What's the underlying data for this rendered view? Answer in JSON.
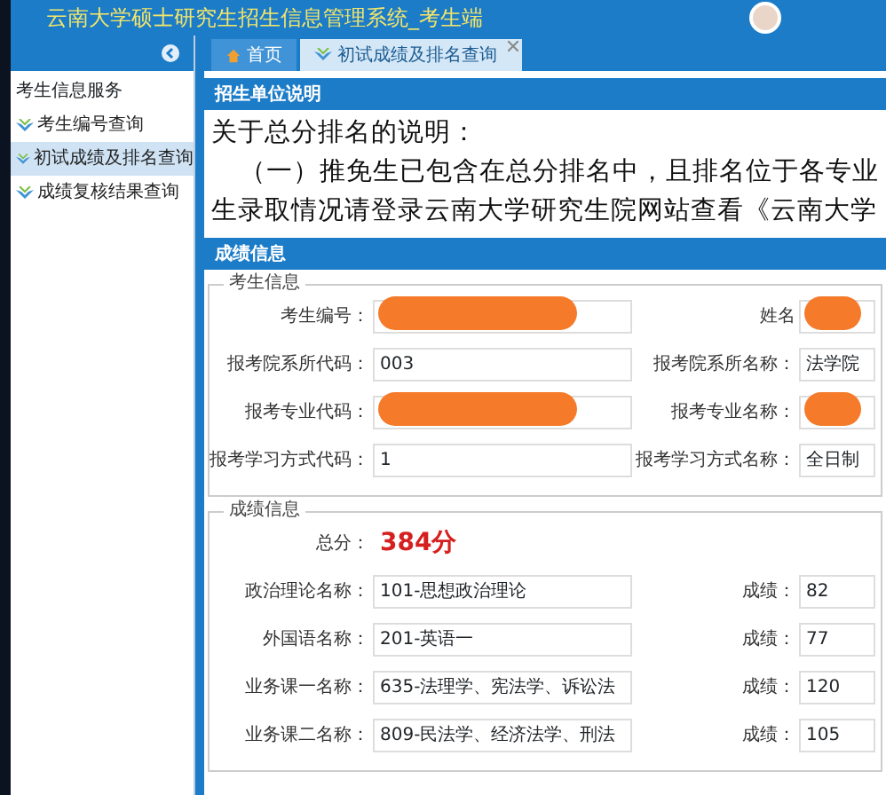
{
  "header": {
    "title": "云南大学硕士研究生招生信息管理系统_考生端"
  },
  "sidebar": {
    "items": [
      {
        "label": "考生信息服务",
        "children": [
          {
            "label": "考生编号查询",
            "selected": false
          },
          {
            "label": "初试成绩及排名查询",
            "selected": true
          },
          {
            "label": "成绩复核结果查询",
            "selected": false
          }
        ]
      }
    ]
  },
  "tabs": [
    {
      "label": "首页",
      "kind": "home",
      "selected": false,
      "closable": false
    },
    {
      "label": "初试成绩及排名查询",
      "kind": "page",
      "selected": true,
      "closable": true
    }
  ],
  "notice": {
    "title": "招生单位说明",
    "heading": "关于总分排名的说明：",
    "lines": [
      "（一）推免生已包含在总分排名中，且排名位于各专业",
      "生录取情况请登录云南大学研究生院网站查看《云南大学"
    ]
  },
  "scores": {
    "title": "成绩信息",
    "candidate": {
      "legend": "考生信息",
      "rows": [
        [
          {
            "label": "考生编号：",
            "redacted": true
          },
          {
            "label": "姓名",
            "redacted": true
          }
        ],
        [
          {
            "label": "报考院系所代码：",
            "value": "003",
            "redacted": false
          },
          {
            "label": "报考院系所名称：",
            "value": "法学院",
            "redacted": false
          }
        ],
        [
          {
            "label": "报考专业代码：",
            "redacted": true
          },
          {
            "label": "报考专业名称：",
            "redacted": true
          }
        ],
        [
          {
            "label": "报考学习方式代码：",
            "value": "1",
            "redacted": false
          },
          {
            "label": "报考学习方式名称：",
            "value": "全日制",
            "redacted": false
          }
        ]
      ]
    },
    "results": {
      "legend": "成绩信息",
      "total_label": "总分：",
      "total": "384分",
      "rows": [
        [
          {
            "label": "政治理论名称：",
            "value": "101-思想政治理论",
            "redacted": false
          },
          {
            "label": "成绩：",
            "value": "82",
            "redacted": false
          }
        ],
        [
          {
            "label": "外国语名称：",
            "value": "201-英语一",
            "redacted": false
          },
          {
            "label": "成绩：",
            "value": "77",
            "redacted": false
          }
        ],
        [
          {
            "label": "业务课一名称：",
            "value": "635-法理学、宪法学、诉讼法",
            "redacted": false
          },
          {
            "label": "成绩：",
            "value": "120",
            "redacted": false
          }
        ],
        [
          {
            "label": "业务课二名称：",
            "value": "809-民法学、经济法学、刑法",
            "redacted": false
          },
          {
            "label": "成绩：",
            "value": "105",
            "redacted": false
          }
        ]
      ]
    }
  }
}
